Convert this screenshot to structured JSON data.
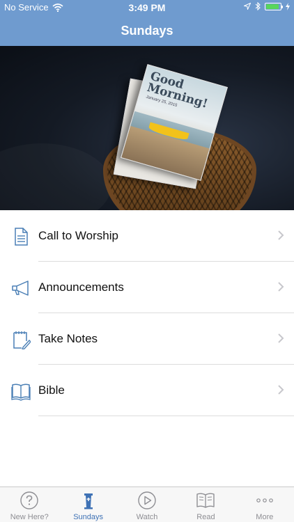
{
  "status_bar": {
    "carrier": "No Service",
    "time": "3:49 PM",
    "battery_level": 0.9
  },
  "nav": {
    "title": "Sundays"
  },
  "hero": {
    "flyer_headline": "Good Morning!",
    "flyer_date": "January 25, 2015"
  },
  "menu": {
    "items": [
      {
        "label": "Call to Worship",
        "icon": "document-icon"
      },
      {
        "label": "Announcements",
        "icon": "megaphone-icon"
      },
      {
        "label": "Take Notes",
        "icon": "notepad-pen-icon"
      },
      {
        "label": "Bible",
        "icon": "open-book-icon"
      }
    ]
  },
  "tabbar": {
    "tabs": [
      {
        "label": "New Here?",
        "icon": "question-circle-icon",
        "active": false
      },
      {
        "label": "Sundays",
        "icon": "pulpit-icon",
        "active": true
      },
      {
        "label": "Watch",
        "icon": "play-circle-icon",
        "active": false
      },
      {
        "label": "Read",
        "icon": "open-book-icon",
        "active": false
      },
      {
        "label": "More",
        "icon": "ellipsis-icon",
        "active": false
      }
    ]
  },
  "colors": {
    "nav_background": "#6f9bcf",
    "accent": "#3f72b5",
    "icon_blue": "#4a7fb5",
    "inactive_tab": "#8e8e93"
  }
}
